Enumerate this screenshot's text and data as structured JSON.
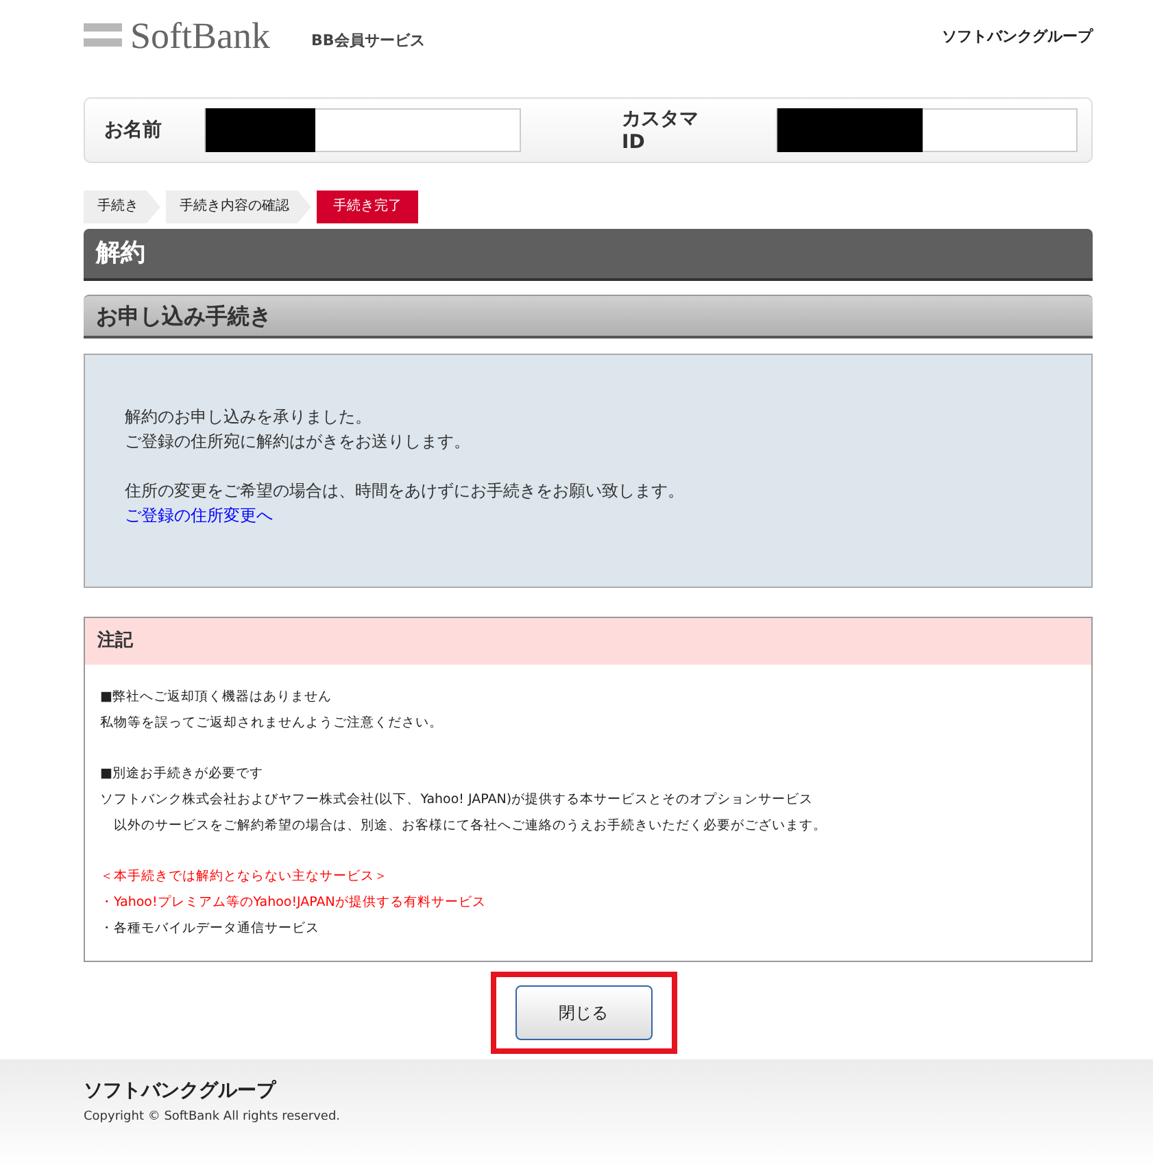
{
  "header": {
    "logo": "SoftBank",
    "service": "BB会員サービス",
    "group_link": "ソフトバンクグループ"
  },
  "customer": [
    {
      "label": "お名前",
      "redacted": true
    },
    {
      "label": "カスタマID",
      "redacted": true
    }
  ],
  "steps": [
    {
      "label": "手続き",
      "selected": false
    },
    {
      "label": "手続き内容の確認",
      "selected": false
    },
    {
      "label": "手続き完了",
      "selected": true
    }
  ],
  "page_title": "解約",
  "section_title": "お申し込み手続き",
  "message": {
    "paragraphs": [
      [
        "解約のお申し込みを承りました。",
        "ご登録の住所宛に解約はがきをお送りします。"
      ],
      [
        "住所の変更をご希望の場合は、時間をあけずにお手続きをお願い致します。"
      ]
    ],
    "link": "ご登録の住所変更へ"
  },
  "note": {
    "title": "注記",
    "groups": [
      [
        {
          "text": "■弊社へご返却頂く機器はありません",
          "kind": "plain"
        },
        {
          "text": "私物等を誤ってご返却されませんようご注意ください。",
          "kind": "plain"
        }
      ],
      [
        {
          "text": "■別途お手続きが必要です",
          "kind": "plain"
        },
        {
          "text": "ソフトバンク株式会社およびヤフー株式会社(以下、Yahoo! JAPAN)が提供する本サービスとそのオプションサービス",
          "kind": "plain"
        },
        {
          "text": "　以外のサービスをご解約希望の場合は、別途、お客様にて各社へご連絡のうえお手続きいただく必要がございます。",
          "kind": "plain"
        }
      ],
      [
        {
          "text": "＜本手続きでは解約とならない主なサービス＞",
          "kind": "warning"
        },
        {
          "text": "・Yahoo!プレミアム等のYahoo!JAPANが提供する有料サービス",
          "kind": "warning"
        },
        {
          "text": "・各種モバイルデータ通信サービス",
          "kind": "plain"
        }
      ]
    ]
  },
  "close_button": {
    "label": "閉じる",
    "highlighted": true
  },
  "footer": {
    "group": "ソフトバンクグループ",
    "copyright": "Copyright © SoftBank All rights reserved."
  }
}
